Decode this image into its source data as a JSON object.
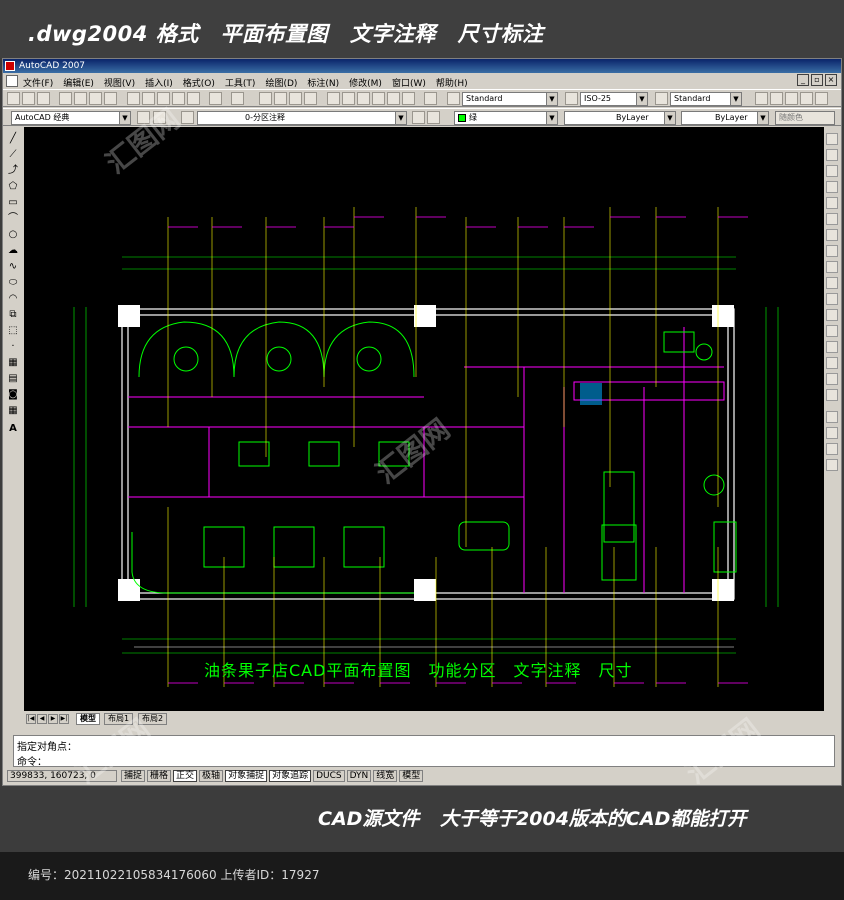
{
  "banner": {
    "parts": [
      ".dwg2004 格式",
      "平面布置图",
      "文字注释",
      "尺寸标注"
    ]
  },
  "window": {
    "title": "AutoCAD 2007",
    "menus": [
      "文件(F)",
      "编辑(E)",
      "视图(V)",
      "插入(I)",
      "格式(O)",
      "工具(T)",
      "绘图(D)",
      "标注(N)",
      "修改(M)",
      "窗口(W)",
      "帮助(H)"
    ]
  },
  "toolbar": {
    "text_style": "Standard",
    "dim_style": "ISO-25",
    "table_style": "Standard",
    "workspace": "AutoCAD 经典",
    "layer": "0-分区注释",
    "color": "绿",
    "linetype": "ByLayer",
    "lineweight": "ByLayer",
    "plotstyle": "随颜色"
  },
  "drawing": {
    "title": "油条果子店CAD平面布置图　功能分区　文字注释　尺寸"
  },
  "tabs": [
    "模型",
    "布局1",
    "布局2"
  ],
  "command": {
    "line1": "指定对角点：",
    "line2": "命令："
  },
  "status": {
    "coords": "399833, 160723, 0",
    "modes": [
      "捕捉",
      "栅格",
      "正交",
      "极轴",
      "对象捕捉",
      "对象追踪",
      "DUCS",
      "DYN",
      "线宽",
      "模型"
    ]
  },
  "caption": {
    "parts": [
      "CAD源文件",
      "大于等于2004版本的CAD都能打开"
    ]
  },
  "footer": {
    "info": "编号：20211022105834176060 上传者ID：17927"
  },
  "watermark": "汇图网"
}
